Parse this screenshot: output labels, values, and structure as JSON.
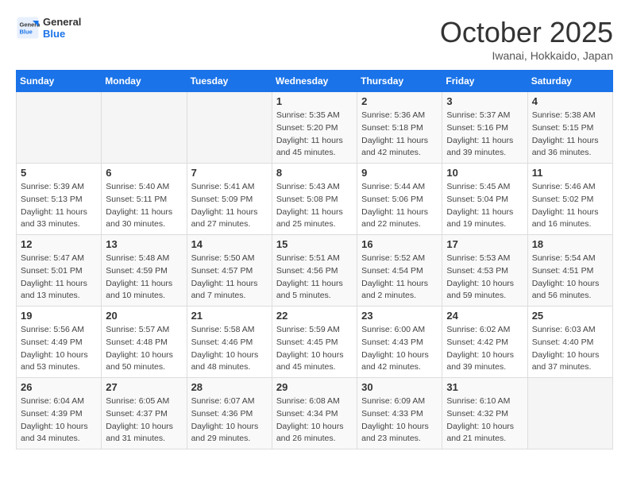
{
  "header": {
    "logo_line1": "General",
    "logo_line2": "Blue",
    "month": "October 2025",
    "location": "Iwanai, Hokkaido, Japan"
  },
  "weekdays": [
    "Sunday",
    "Monday",
    "Tuesday",
    "Wednesday",
    "Thursday",
    "Friday",
    "Saturday"
  ],
  "weeks": [
    [
      {
        "day": "",
        "sunrise": "",
        "sunset": "",
        "daylight": ""
      },
      {
        "day": "",
        "sunrise": "",
        "sunset": "",
        "daylight": ""
      },
      {
        "day": "",
        "sunrise": "",
        "sunset": "",
        "daylight": ""
      },
      {
        "day": "1",
        "sunrise": "Sunrise: 5:35 AM",
        "sunset": "Sunset: 5:20 PM",
        "daylight": "Daylight: 11 hours and 45 minutes."
      },
      {
        "day": "2",
        "sunrise": "Sunrise: 5:36 AM",
        "sunset": "Sunset: 5:18 PM",
        "daylight": "Daylight: 11 hours and 42 minutes."
      },
      {
        "day": "3",
        "sunrise": "Sunrise: 5:37 AM",
        "sunset": "Sunset: 5:16 PM",
        "daylight": "Daylight: 11 hours and 39 minutes."
      },
      {
        "day": "4",
        "sunrise": "Sunrise: 5:38 AM",
        "sunset": "Sunset: 5:15 PM",
        "daylight": "Daylight: 11 hours and 36 minutes."
      }
    ],
    [
      {
        "day": "5",
        "sunrise": "Sunrise: 5:39 AM",
        "sunset": "Sunset: 5:13 PM",
        "daylight": "Daylight: 11 hours and 33 minutes."
      },
      {
        "day": "6",
        "sunrise": "Sunrise: 5:40 AM",
        "sunset": "Sunset: 5:11 PM",
        "daylight": "Daylight: 11 hours and 30 minutes."
      },
      {
        "day": "7",
        "sunrise": "Sunrise: 5:41 AM",
        "sunset": "Sunset: 5:09 PM",
        "daylight": "Daylight: 11 hours and 27 minutes."
      },
      {
        "day": "8",
        "sunrise": "Sunrise: 5:43 AM",
        "sunset": "Sunset: 5:08 PM",
        "daylight": "Daylight: 11 hours and 25 minutes."
      },
      {
        "day": "9",
        "sunrise": "Sunrise: 5:44 AM",
        "sunset": "Sunset: 5:06 PM",
        "daylight": "Daylight: 11 hours and 22 minutes."
      },
      {
        "day": "10",
        "sunrise": "Sunrise: 5:45 AM",
        "sunset": "Sunset: 5:04 PM",
        "daylight": "Daylight: 11 hours and 19 minutes."
      },
      {
        "day": "11",
        "sunrise": "Sunrise: 5:46 AM",
        "sunset": "Sunset: 5:02 PM",
        "daylight": "Daylight: 11 hours and 16 minutes."
      }
    ],
    [
      {
        "day": "12",
        "sunrise": "Sunrise: 5:47 AM",
        "sunset": "Sunset: 5:01 PM",
        "daylight": "Daylight: 11 hours and 13 minutes."
      },
      {
        "day": "13",
        "sunrise": "Sunrise: 5:48 AM",
        "sunset": "Sunset: 4:59 PM",
        "daylight": "Daylight: 11 hours and 10 minutes."
      },
      {
        "day": "14",
        "sunrise": "Sunrise: 5:50 AM",
        "sunset": "Sunset: 4:57 PM",
        "daylight": "Daylight: 11 hours and 7 minutes."
      },
      {
        "day": "15",
        "sunrise": "Sunrise: 5:51 AM",
        "sunset": "Sunset: 4:56 PM",
        "daylight": "Daylight: 11 hours and 5 minutes."
      },
      {
        "day": "16",
        "sunrise": "Sunrise: 5:52 AM",
        "sunset": "Sunset: 4:54 PM",
        "daylight": "Daylight: 11 hours and 2 minutes."
      },
      {
        "day": "17",
        "sunrise": "Sunrise: 5:53 AM",
        "sunset": "Sunset: 4:53 PM",
        "daylight": "Daylight: 10 hours and 59 minutes."
      },
      {
        "day": "18",
        "sunrise": "Sunrise: 5:54 AM",
        "sunset": "Sunset: 4:51 PM",
        "daylight": "Daylight: 10 hours and 56 minutes."
      }
    ],
    [
      {
        "day": "19",
        "sunrise": "Sunrise: 5:56 AM",
        "sunset": "Sunset: 4:49 PM",
        "daylight": "Daylight: 10 hours and 53 minutes."
      },
      {
        "day": "20",
        "sunrise": "Sunrise: 5:57 AM",
        "sunset": "Sunset: 4:48 PM",
        "daylight": "Daylight: 10 hours and 50 minutes."
      },
      {
        "day": "21",
        "sunrise": "Sunrise: 5:58 AM",
        "sunset": "Sunset: 4:46 PM",
        "daylight": "Daylight: 10 hours and 48 minutes."
      },
      {
        "day": "22",
        "sunrise": "Sunrise: 5:59 AM",
        "sunset": "Sunset: 4:45 PM",
        "daylight": "Daylight: 10 hours and 45 minutes."
      },
      {
        "day": "23",
        "sunrise": "Sunrise: 6:00 AM",
        "sunset": "Sunset: 4:43 PM",
        "daylight": "Daylight: 10 hours and 42 minutes."
      },
      {
        "day": "24",
        "sunrise": "Sunrise: 6:02 AM",
        "sunset": "Sunset: 4:42 PM",
        "daylight": "Daylight: 10 hours and 39 minutes."
      },
      {
        "day": "25",
        "sunrise": "Sunrise: 6:03 AM",
        "sunset": "Sunset: 4:40 PM",
        "daylight": "Daylight: 10 hours and 37 minutes."
      }
    ],
    [
      {
        "day": "26",
        "sunrise": "Sunrise: 6:04 AM",
        "sunset": "Sunset: 4:39 PM",
        "daylight": "Daylight: 10 hours and 34 minutes."
      },
      {
        "day": "27",
        "sunrise": "Sunrise: 6:05 AM",
        "sunset": "Sunset: 4:37 PM",
        "daylight": "Daylight: 10 hours and 31 minutes."
      },
      {
        "day": "28",
        "sunrise": "Sunrise: 6:07 AM",
        "sunset": "Sunset: 4:36 PM",
        "daylight": "Daylight: 10 hours and 29 minutes."
      },
      {
        "day": "29",
        "sunrise": "Sunrise: 6:08 AM",
        "sunset": "Sunset: 4:34 PM",
        "daylight": "Daylight: 10 hours and 26 minutes."
      },
      {
        "day": "30",
        "sunrise": "Sunrise: 6:09 AM",
        "sunset": "Sunset: 4:33 PM",
        "daylight": "Daylight: 10 hours and 23 minutes."
      },
      {
        "day": "31",
        "sunrise": "Sunrise: 6:10 AM",
        "sunset": "Sunset: 4:32 PM",
        "daylight": "Daylight: 10 hours and 21 minutes."
      },
      {
        "day": "",
        "sunrise": "",
        "sunset": "",
        "daylight": ""
      }
    ]
  ]
}
